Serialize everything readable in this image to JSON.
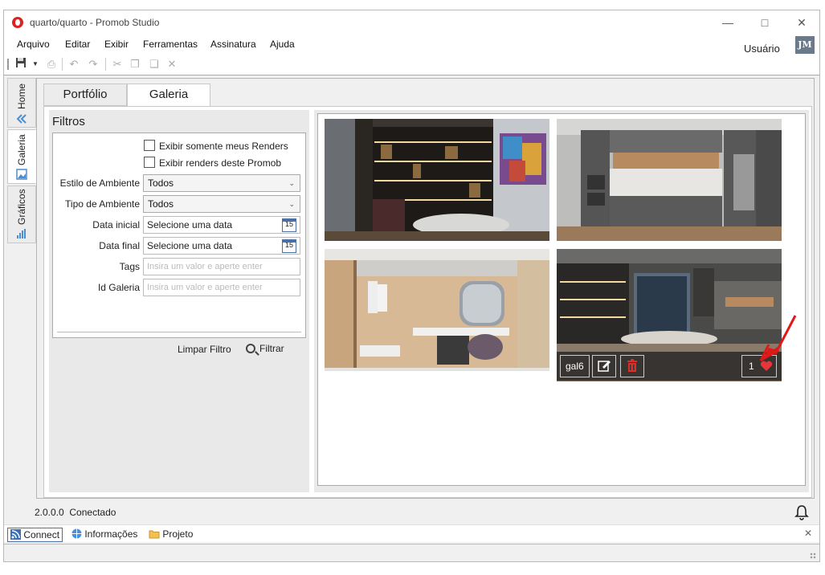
{
  "window": {
    "title": "quarto/quarto - Promob Studio"
  },
  "menu": [
    "Arquivo",
    "Editar",
    "Exibir",
    "Ferramentas",
    "Assinatura",
    "Ajuda"
  ],
  "user": {
    "label": "Usuário",
    "initials": "JM"
  },
  "side_tabs": [
    "Home",
    "Galeria",
    "Gráficos"
  ],
  "tabs": [
    "Portfólio",
    "Galeria"
  ],
  "filters": {
    "title": "Filtros",
    "check_my_renders": "Exibir somente meus Renders",
    "check_this_promob": "Exibir renders deste Promob",
    "style_label": "Estilo de Ambiente",
    "style_value": "Todos",
    "type_label": "Tipo de Ambiente",
    "type_value": "Todos",
    "start_label": "Data inicial",
    "start_placeholder": "Selecione uma data",
    "end_label": "Data final",
    "end_placeholder": "Selecione uma data",
    "calendar_day": "15",
    "tags_label": "Tags",
    "tags_placeholder": "Insira um valor e aperte enter",
    "id_label": "Id Galeria",
    "id_placeholder": "Insira um valor e aperte enter",
    "clear_button": "Limpar Filtro",
    "filter_button": "Filtrar"
  },
  "gallery": {
    "hovered_item": {
      "id": "gal6",
      "likes": "1"
    }
  },
  "status": {
    "version": "2.0.0.0",
    "connection": "Conectado",
    "tabs": [
      "Connect",
      "Informações",
      "Projeto"
    ]
  },
  "colors": {
    "accent": "#4a6fa5",
    "delete": "#d9302c",
    "heart": "#e8353b",
    "annotation_arrow": "#e01818"
  }
}
